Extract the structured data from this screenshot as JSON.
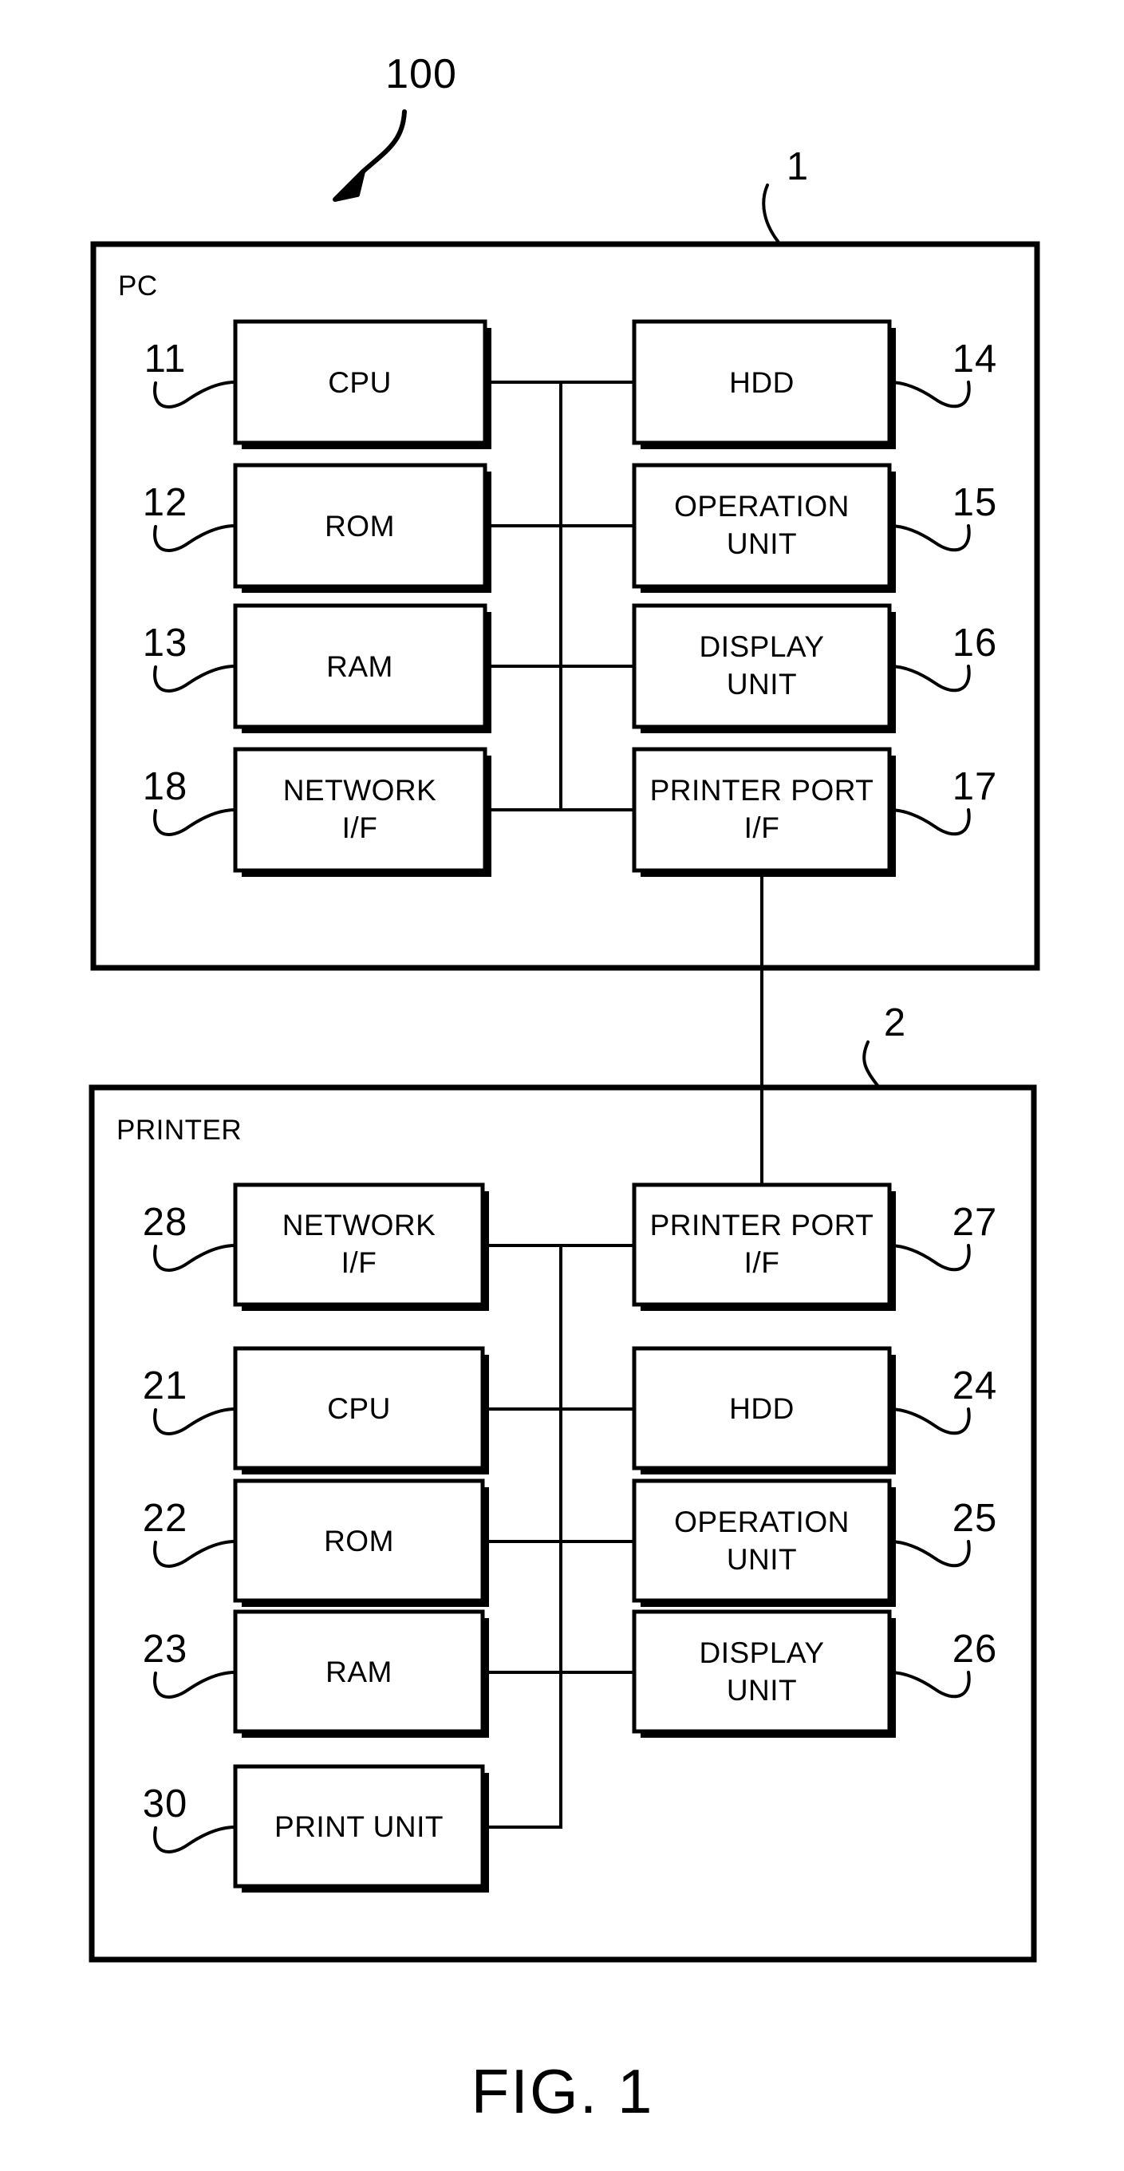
{
  "figure": {
    "caption": "FIG. 1",
    "system_ref": "100"
  },
  "pc": {
    "ref": "1",
    "label": "PC",
    "components": [
      {
        "ref": "11",
        "label": "CPU",
        "line2": "",
        "column": "left",
        "row": 1
      },
      {
        "ref": "12",
        "label": "ROM",
        "line2": "",
        "column": "left",
        "row": 2
      },
      {
        "ref": "13",
        "label": "RAM",
        "line2": "",
        "column": "left",
        "row": 3
      },
      {
        "ref": "18",
        "label": "NETWORK",
        "line2": "I/F",
        "column": "left",
        "row": 4
      },
      {
        "ref": "14",
        "label": "HDD",
        "line2": "",
        "column": "right",
        "row": 1
      },
      {
        "ref": "15",
        "label": "OPERATION",
        "line2": "UNIT",
        "column": "right",
        "row": 2
      },
      {
        "ref": "16",
        "label": "DISPLAY",
        "line2": "UNIT",
        "column": "right",
        "row": 3
      },
      {
        "ref": "17",
        "label": "PRINTER PORT",
        "line2": "I/F",
        "column": "right",
        "row": 4
      }
    ]
  },
  "printer": {
    "ref": "2",
    "label": "PRINTER",
    "components": [
      {
        "ref": "28",
        "label": "NETWORK",
        "line2": "I/F",
        "column": "left",
        "row": 1
      },
      {
        "ref": "21",
        "label": "CPU",
        "line2": "",
        "column": "left",
        "row": 2
      },
      {
        "ref": "22",
        "label": "ROM",
        "line2": "",
        "column": "left",
        "row": 3
      },
      {
        "ref": "23",
        "label": "RAM",
        "line2": "",
        "column": "left",
        "row": 4
      },
      {
        "ref": "30",
        "label": "PRINT UNIT",
        "line2": "",
        "column": "left",
        "row": 5
      },
      {
        "ref": "27",
        "label": "PRINTER PORT",
        "line2": "I/F",
        "column": "right",
        "row": 1
      },
      {
        "ref": "24",
        "label": "HDD",
        "line2": "",
        "column": "right",
        "row": 2
      },
      {
        "ref": "25",
        "label": "OPERATION",
        "line2": "UNIT",
        "column": "right",
        "row": 3
      },
      {
        "ref": "26",
        "label": "DISPLAY",
        "line2": "UNIT",
        "column": "right",
        "row": 4
      }
    ]
  },
  "colors": {
    "ink": "#000000",
    "paper": "#ffffff"
  }
}
